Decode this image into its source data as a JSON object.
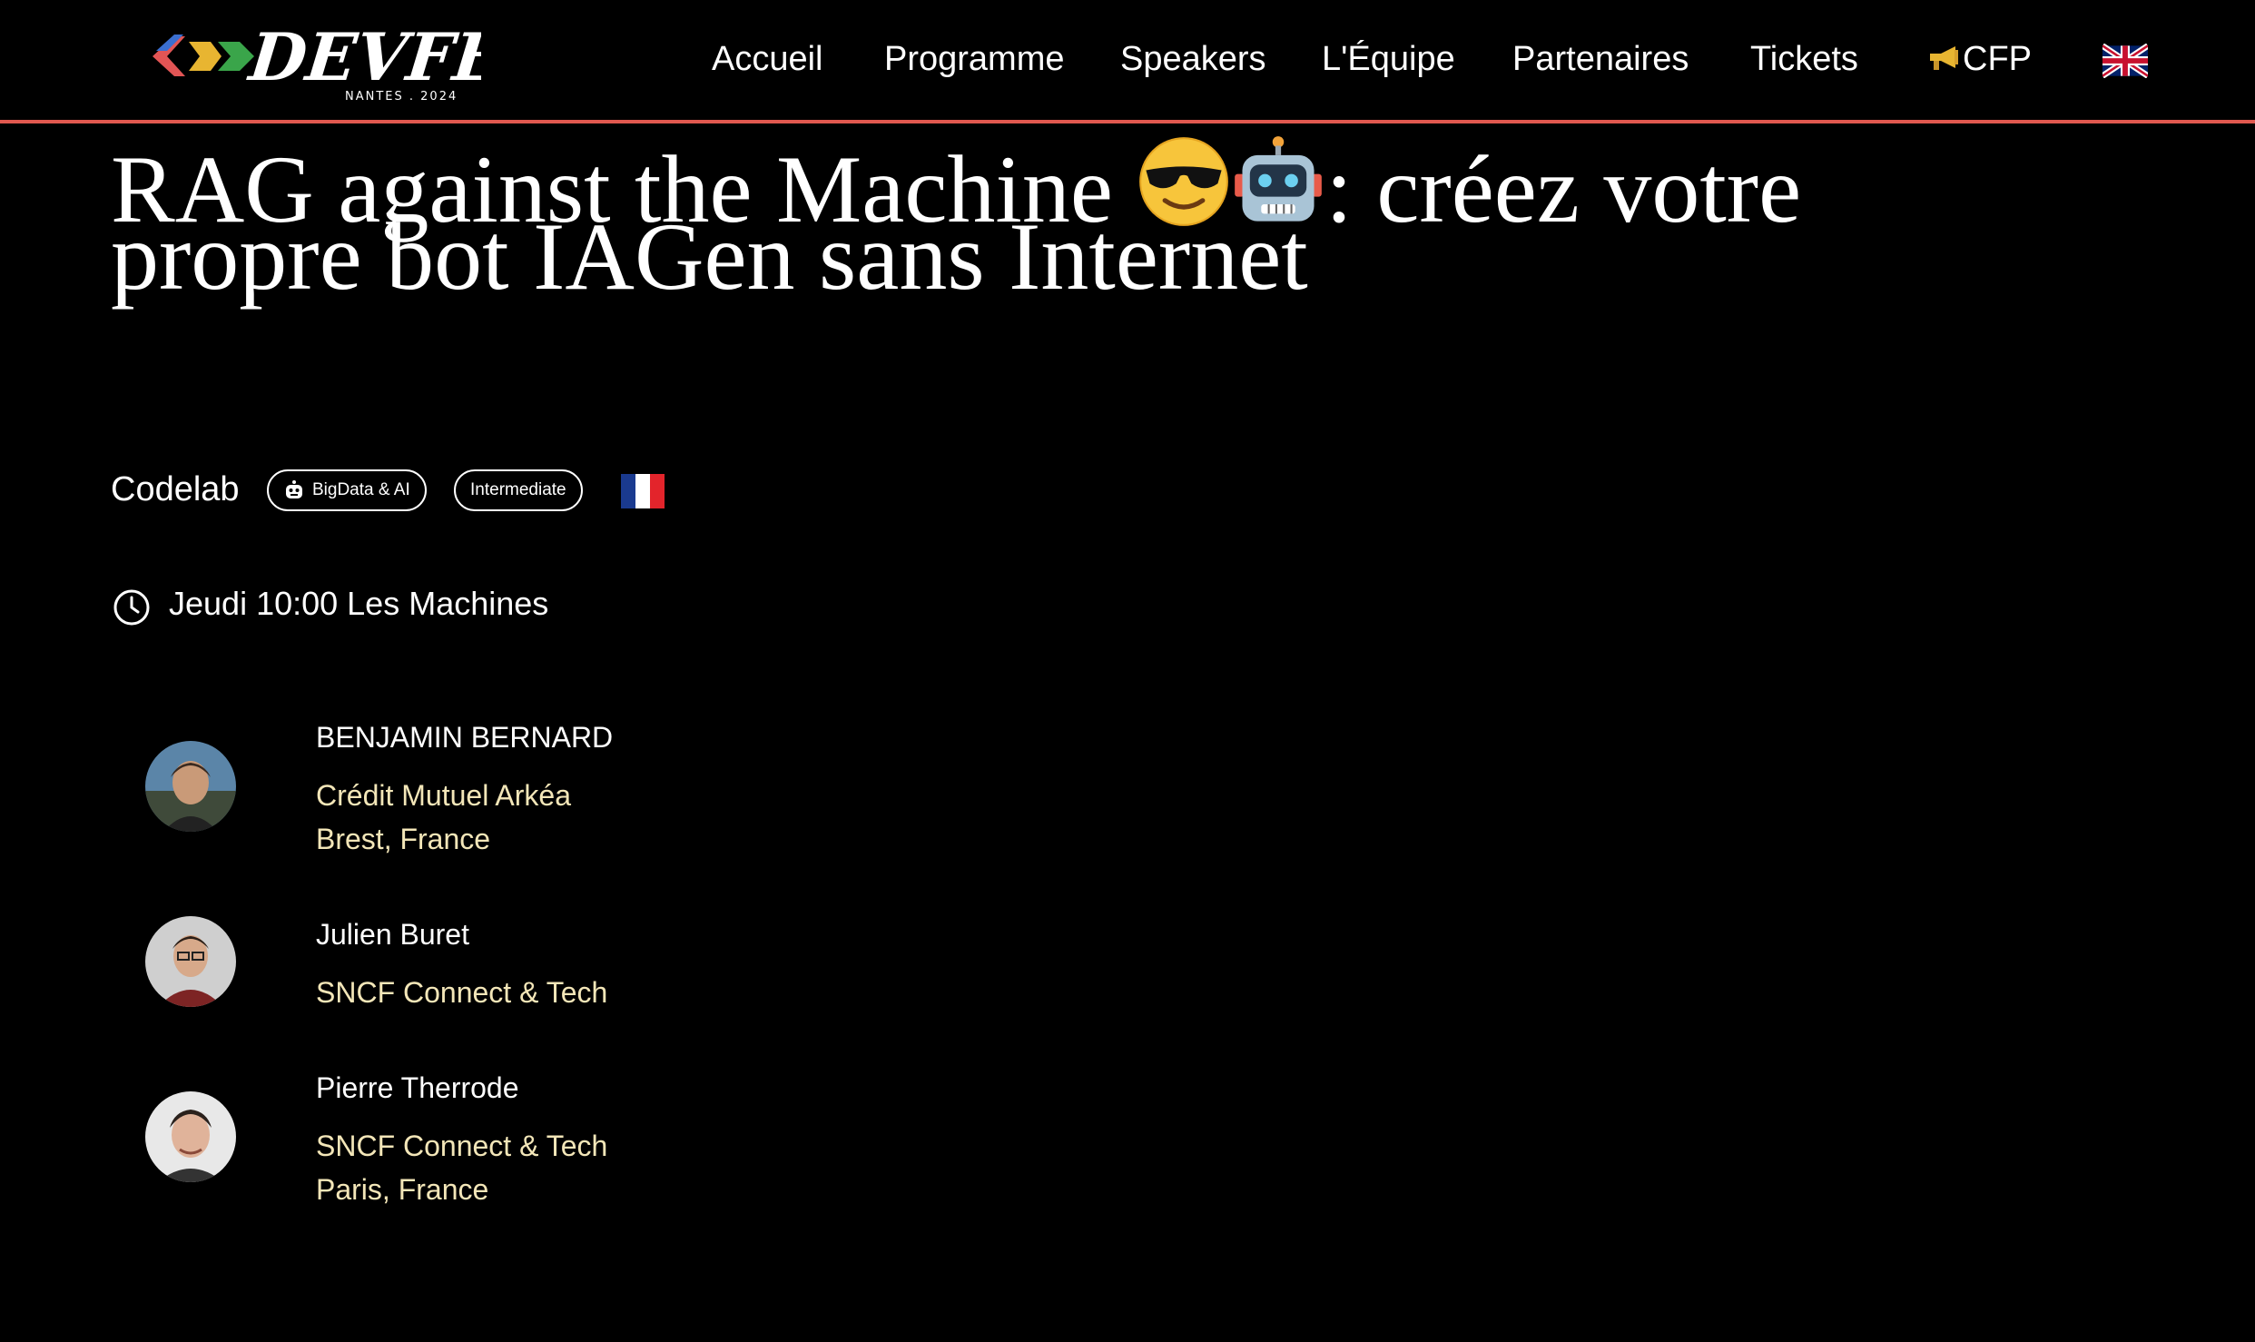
{
  "header": {
    "logo_text": "DEVFEST",
    "logo_subtext": "NANTES . 2024",
    "nav": [
      "Accueil",
      "Programme",
      "Speakers",
      "L'Équipe",
      "Partenaires",
      "Tickets",
      "CFP"
    ],
    "cfp_icon": "megaphone-icon",
    "language_icon": "uk-flag-icon",
    "accent_color": "#e0584f"
  },
  "talk": {
    "title_line1_before": "RAG against the Machine ",
    "title_line1_after": ": créez votre",
    "title_line2": "propre bot IAGen sans Internet",
    "title_emojis": [
      "sunglasses-face-emoji",
      "robot-emoji"
    ],
    "format": "Codelab",
    "category": "BigData & AI",
    "category_icon": "robot-icon",
    "level": "Intermediate",
    "language_icon": "french-flag-icon",
    "schedule": "Jeudi 10:00 Les Machines",
    "schedule_icon": "clock-icon"
  },
  "speakers": [
    {
      "name": "BENJAMIN BERNARD",
      "company": "Crédit Mutuel Arkéa",
      "location": "Brest, France"
    },
    {
      "name": "Julien Buret",
      "company": "SNCF Connect & Tech",
      "location": ""
    },
    {
      "name": "Pierre Therrode",
      "company": "SNCF Connect & Tech",
      "location": "Paris, France"
    }
  ]
}
